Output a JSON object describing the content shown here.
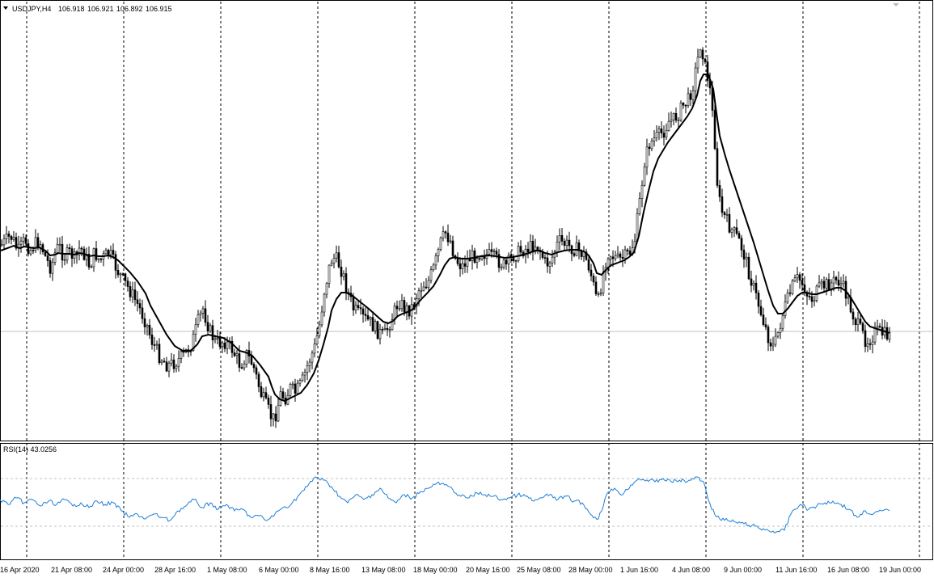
{
  "header": {
    "symbol": "USDJPY,H4",
    "open": "106.918",
    "high": "106.921",
    "low": "106.892",
    "close": "106.915"
  },
  "rsi_label": "RSI(14) 43.0256",
  "time_labels": [
    "16 Apr 2020",
    "21 Apr 08:00",
    "24 Apr 00:00",
    "28 Apr 16:00",
    "1 May 08:00",
    "6 May 00:00",
    "8 May 16:00",
    "13 May 08:00",
    "18 May 00:00",
    "20 May 16:00",
    "25 May 08:00",
    "28 May 00:00",
    "1 Jun 16:00",
    "4 Jun 08:00",
    "9 Jun 00:00",
    "11 Jun 16:00",
    "16 Jun 08:00",
    "19 Jun 00:00"
  ],
  "colors": {
    "candles": "#000000",
    "moving_average": "#000000",
    "rsi_line": "#1e7fd6",
    "grid": "#000000",
    "level_lines": "#c0c0c0"
  },
  "chart_data": [
    {
      "type": "candlestick",
      "title": "USDJPY,H4",
      "series": [
        {
          "name": "price",
          "x": [
            1,
            12,
            17,
            21,
            25,
            30,
            36,
            42,
            48,
            56,
            62,
            68,
            72,
            78,
            86,
            92,
            98,
            104,
            110,
            116,
            122,
            128,
            134,
            140,
            146,
            152,
            160,
            170,
            180,
            186,
            196,
            206,
            216,
            226,
            236,
            244,
            250,
            258,
            266,
            276,
            286,
            296,
            304,
            312,
            322,
            332,
            336,
            340,
            346,
            352,
            358,
            364,
            372,
            380,
            388,
            394,
            400,
            406,
            410,
            416,
            422,
            428,
            436,
            446,
            456,
            466,
            474,
            480,
            486,
            492,
            498,
            504,
            510,
            516,
            522,
            528,
            536,
            544,
            550,
            556,
            562,
            570,
            578,
            586,
            594,
            604,
            614,
            624,
            634,
            644,
            654,
            662,
            668,
            674,
            682,
            690,
            698,
            706,
            714,
            722,
            728,
            734,
            738,
            744,
            750,
            756,
            764,
            772,
            778,
            784,
            790,
            796,
            802,
            808,
            814,
            820,
            826,
            832,
            838,
            844,
            850,
            856,
            862,
            866,
            870,
            876,
            882,
            886,
            890,
            896,
            902,
            908,
            914,
            920,
            926,
            932,
            938,
            944,
            950,
            956,
            962,
            968,
            974,
            980,
            986,
            992,
            998,
            1004,
            1010,
            1016,
            1022,
            1028,
            1034,
            1040,
            1046,
            1052,
            1058,
            1064,
            1070,
            1076,
            1082,
            1088,
            1094,
            1100
          ],
          "y": [
            303,
            292,
            300,
            312,
            305,
            296,
            310,
            302,
            298,
            320,
            332,
            310,
            304,
            318,
            312,
            322,
            305,
            316,
            330,
            312,
            322,
            318,
            312,
            326,
            338,
            348,
            360,
            378,
            400,
            420,
            440,
            452,
            448,
            440,
            425,
            398,
            382,
            408,
            425,
            422,
            432,
            452,
            438,
            452,
            488,
            510,
            520,
            512,
            488,
            492,
            480,
            486,
            474,
            450,
            430,
            402,
            360,
            332,
            318,
            322,
            336,
            358,
            382,
            392,
            398,
            410,
            416,
            402,
            388,
            372,
            380,
            384,
            378,
            360,
            352,
            350,
            330,
            300,
            288,
            298,
            320,
            330,
            320,
            316,
            312,
            316,
            322,
            330,
            316,
            310,
            306,
            302,
            312,
            328,
            318,
            298,
            302,
            306,
            310,
            316,
            332,
            358,
            378,
            342,
            312,
            316,
            322,
            318,
            312,
            296,
            250,
            200,
            178,
            172,
            168,
            162,
            150,
            148,
            140,
            130,
            124,
            105,
            72,
            50,
            80,
            102,
            160,
            225,
            258,
            270,
            282,
            290,
            300,
            318,
            340,
            360,
            380,
            400,
            420,
            430,
            408,
            385,
            368,
            352,
            344,
            352,
            366,
            370,
            360,
            354,
            352,
            350,
            346,
            352,
            366,
            384,
            400,
            410,
            422,
            418,
            410,
            412,
            414,
            416
          ]
        }
      ],
      "line_overlay": {
        "name": "moving_average",
        "x": [
          1,
          12,
          17,
          21,
          25,
          30,
          36,
          42,
          48,
          56,
          62,
          68,
          72,
          78,
          86,
          92,
          98,
          104,
          110,
          116,
          122,
          128,
          134,
          140,
          146,
          152,
          160,
          170,
          180,
          186,
          196,
          206,
          216,
          226,
          236,
          244,
          250,
          258,
          266,
          276,
          286,
          296,
          304,
          312,
          322,
          332,
          336,
          340,
          346,
          352,
          358,
          364,
          372,
          380,
          388,
          394,
          400,
          406,
          410,
          416,
          422,
          428,
          436,
          446,
          456,
          466,
          474,
          480,
          486,
          492,
          498,
          504,
          510,
          516,
          522,
          528,
          536,
          544,
          550,
          556,
          562,
          570,
          578,
          586,
          594,
          604,
          614,
          624,
          634,
          644,
          654,
          662,
          668,
          674,
          682,
          690,
          698,
          706,
          714,
          722,
          728,
          734,
          738,
          744,
          750,
          756,
          764,
          772,
          778,
          784,
          790,
          796,
          802,
          808,
          814,
          820,
          826,
          832,
          838,
          844,
          850,
          856,
          862,
          866,
          870,
          876,
          882,
          886,
          890,
          896,
          902,
          908,
          914,
          920,
          926,
          932,
          938,
          944,
          950,
          956,
          962,
          968,
          974,
          980,
          986,
          992,
          998,
          1004,
          1010,
          1016,
          1022,
          1028,
          1034,
          1040,
          1046,
          1052,
          1058,
          1064,
          1070,
          1076,
          1082,
          1088,
          1094,
          1100
        ],
        "y": [
          310,
          306,
          304,
          306,
          307,
          305,
          306,
          307,
          306,
          310,
          316,
          315,
          313,
          314,
          314,
          315,
          313,
          314,
          317,
          316,
          317,
          317,
          316,
          318,
          322,
          328,
          336,
          348,
          363,
          378,
          396,
          414,
          428,
          434,
          434,
          426,
          416,
          414,
          416,
          418,
          424,
          434,
          436,
          440,
          452,
          466,
          478,
          488,
          494,
          496,
          493,
          490,
          486,
          476,
          462,
          446,
          426,
          404,
          384,
          370,
          362,
          362,
          366,
          374,
          382,
          391,
          398,
          400,
          397,
          391,
          388,
          386,
          383,
          376,
          369,
          363,
          354,
          340,
          328,
          320,
          318,
          320,
          320,
          319,
          317,
          316,
          317,
          319,
          318,
          316,
          313,
          310,
          310,
          313,
          315,
          312,
          310,
          309,
          309,
          311,
          316,
          326,
          338,
          340,
          333,
          328,
          325,
          322,
          318,
          312,
          292,
          262,
          236,
          212,
          196,
          186,
          176,
          168,
          160,
          152,
          144,
          134,
          118,
          100,
          92,
          92,
          110,
          140,
          168,
          190,
          210,
          228,
          246,
          264,
          282,
          300,
          320,
          340,
          360,
          378,
          388,
          388,
          382,
          374,
          366,
          362,
          362,
          364,
          364,
          362,
          360,
          358,
          356,
          356,
          360,
          368,
          378,
          388,
          398,
          404,
          406,
          408,
          410,
          412
        ]
      }
    },
    {
      "type": "line",
      "title": "RSI(14) 43.0256",
      "series": [
        {
          "name": "RSI",
          "x": [
            0,
            10,
            20,
            30,
            40,
            50,
            60,
            70,
            80,
            90,
            100,
            110,
            120,
            130,
            140,
            150,
            160,
            170,
            180,
            190,
            200,
            210,
            220,
            230,
            240,
            250,
            260,
            270,
            280,
            290,
            300,
            310,
            320,
            330,
            340,
            350,
            360,
            370,
            380,
            390,
            400,
            410,
            420,
            430,
            440,
            450,
            460,
            470,
            480,
            490,
            500,
            510,
            520,
            530,
            540,
            550,
            560,
            570,
            580,
            590,
            600,
            610,
            620,
            630,
            640,
            650,
            660,
            670,
            680,
            690,
            700,
            710,
            720,
            730,
            740,
            750,
            760,
            770,
            780,
            790,
            800,
            810,
            820,
            830,
            840,
            850,
            860,
            870,
            880,
            890,
            900,
            910,
            920,
            930,
            940,
            950,
            960,
            970,
            980,
            990,
            1000,
            1010,
            1020,
            1030,
            1040,
            1050,
            1060,
            1070,
            1080,
            1090,
            1100
          ],
          "y": [
            618,
            624,
            616,
            622,
            618,
            626,
            620,
            624,
            618,
            626,
            622,
            628,
            620,
            624,
            622,
            632,
            640,
            636,
            642,
            636,
            640,
            644,
            632,
            626,
            618,
            628,
            622,
            630,
            624,
            632,
            630,
            640,
            638,
            644,
            636,
            628,
            624,
            612,
            602,
            590,
            594,
            602,
            614,
            622,
            612,
            618,
            612,
            604,
            616,
            622,
            612,
            616,
            608,
            604,
            598,
            600,
            606,
            614,
            616,
            610,
            612,
            614,
            618,
            616,
            612,
            614,
            620,
            616,
            612,
            618,
            614,
            620,
            622,
            636,
            642,
            612,
            604,
            612,
            600,
            592,
            594,
            596,
            592,
            596,
            594,
            596,
            590,
            596,
            630,
            642,
            644,
            646,
            648,
            650,
            654,
            656,
            658,
            656,
            632,
            624,
            630,
            626,
            622,
            620,
            624,
            630,
            640,
            632,
            636,
            632,
            632
          ]
        }
      ],
      "levels": [
        70,
        30
      ]
    }
  ]
}
